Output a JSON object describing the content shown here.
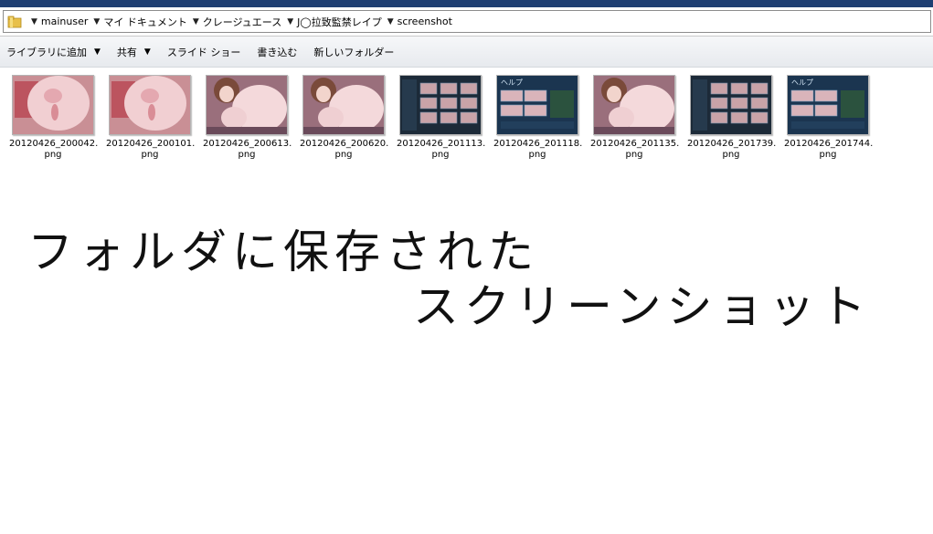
{
  "breadcrumb": {
    "items": [
      "mainuser",
      "マイ ドキュメント",
      "クレージュエース",
      "J◯拉致監禁レイプ",
      "screenshot"
    ]
  },
  "toolbar": {
    "library_label": "ライブラリに追加",
    "share_label": "共有",
    "slideshow_label": "スライド ショー",
    "burn_label": "書き込む",
    "new_folder_label": "新しいフォルダー"
  },
  "files": [
    {
      "name": "20120426_200042.",
      "ext": "png",
      "thumb": "pink"
    },
    {
      "name": "20120426_200101.",
      "ext": "png",
      "thumb": "pink"
    },
    {
      "name": "20120426_200613.",
      "ext": "png",
      "thumb": "pink-girl"
    },
    {
      "name": "20120426_200620.",
      "ext": "png",
      "thumb": "pink-girl"
    },
    {
      "name": "20120426_201113.",
      "ext": "png",
      "thumb": "dark-grid"
    },
    {
      "name": "20120426_201118.",
      "ext": "png",
      "thumb": "dark-help"
    },
    {
      "name": "20120426_201135.",
      "ext": "png",
      "thumb": "pink-girl"
    },
    {
      "name": "20120426_201739.",
      "ext": "png",
      "thumb": "dark-grid"
    },
    {
      "name": "20120426_201744.",
      "ext": "png",
      "thumb": "dark-help"
    }
  ],
  "caption": {
    "line1": "フォルダに保存された",
    "line2": "スクリーンショット"
  },
  "colors": {
    "title_bar": "#1f3f73",
    "thumb_pink": "#e7b6bd",
    "thumb_dark": "#1e2d3d"
  }
}
